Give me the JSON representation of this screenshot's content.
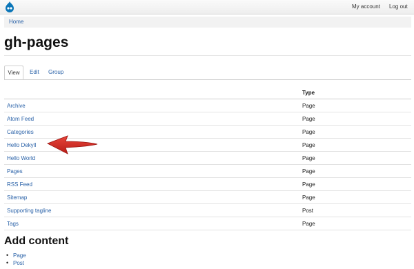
{
  "topbar": {
    "logo_icon": "drupal-drop-icon",
    "my_account": "My account",
    "log_out": "Log out"
  },
  "breadcrumb": {
    "home": "Home"
  },
  "page": {
    "title": "gh-pages"
  },
  "tabs": [
    {
      "label": "View",
      "active": true
    },
    {
      "label": "Edit",
      "active": false
    },
    {
      "label": "Group",
      "active": false
    }
  ],
  "table": {
    "columns": [
      "",
      "Type"
    ],
    "rows": [
      {
        "title": "Archive",
        "type": "Page"
      },
      {
        "title": "Atom Feed",
        "type": "Page"
      },
      {
        "title": "Categories",
        "type": "Page"
      },
      {
        "title": "Hello Dekyll",
        "type": "Page"
      },
      {
        "title": "Hello World",
        "type": "Page"
      },
      {
        "title": "Pages",
        "type": "Page"
      },
      {
        "title": "RSS Feed",
        "type": "Page"
      },
      {
        "title": "Sitemap",
        "type": "Page"
      },
      {
        "title": "Supporting tagline",
        "type": "Post"
      },
      {
        "title": "Tags",
        "type": "Page"
      }
    ]
  },
  "annotation": {
    "arrow_icon": "red-arrow-icon",
    "arrow_color": "#d42a22"
  },
  "add_content": {
    "title": "Add content",
    "items": [
      "Page",
      "Post"
    ]
  },
  "colors": {
    "link": "#2a62a8",
    "logo": "#0b76b8"
  }
}
